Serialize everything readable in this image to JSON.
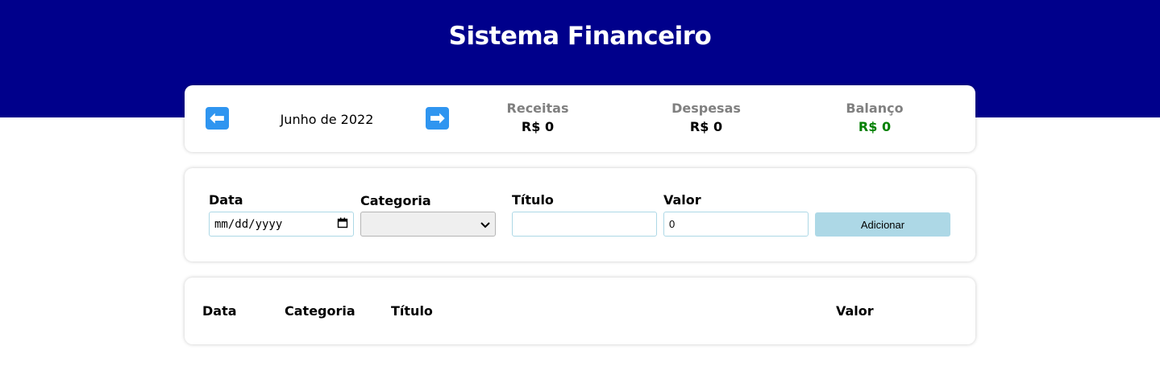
{
  "header": {
    "title": "Sistema Financeiro",
    "bg_color": "#00008b"
  },
  "info": {
    "prev_icon": "left-arrow-icon",
    "prev_glyph": "⬅",
    "next_icon": "right-arrow-icon",
    "next_glyph": "➡",
    "month": "Junho de 2022",
    "receitas": {
      "label": "Receitas",
      "value": "R$ 0"
    },
    "despesas": {
      "label": "Despesas",
      "value": "R$ 0"
    },
    "balanco": {
      "label": "Balanço",
      "value": "R$ 0",
      "color": "#008000"
    }
  },
  "form": {
    "data": {
      "label": "Data",
      "placeholder": "mm/dd/yyyy",
      "icon": "calendar-icon"
    },
    "categoria": {
      "label": "Categoria",
      "value": "",
      "icon": "chevron-down-icon"
    },
    "titulo": {
      "label": "Título",
      "value": ""
    },
    "valor": {
      "label": "Valor",
      "value": "0"
    },
    "add_button": "Adicionar",
    "accent": "#add8e6"
  },
  "table": {
    "headers": [
      "Data",
      "Categoria",
      "Título",
      "Valor"
    ]
  }
}
